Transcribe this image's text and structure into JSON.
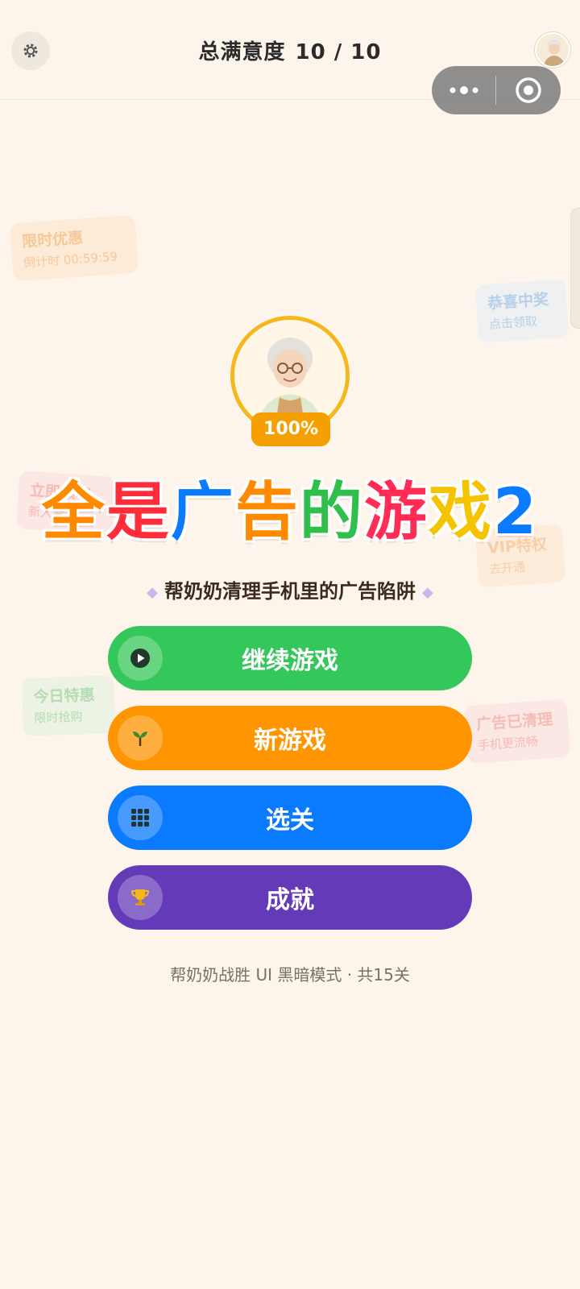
{
  "header": {
    "title": "总满意度",
    "score": "10 / 10"
  },
  "ad_tags": [
    {
      "line1": "限时优惠",
      "line2": "倒计时 00:59:59"
    },
    {
      "line1": "恭喜中奖",
      "line2": "点击领取"
    },
    {
      "line1": "立即领取",
      "line2": "新人专享"
    },
    {
      "line1": "VIP特权",
      "line2": "去开通"
    },
    {
      "line1": "今日特惠",
      "line2": "限时抢购"
    },
    {
      "line1": "广告已清理",
      "line2": "手机更流畅"
    }
  ],
  "hero": {
    "satisfaction_badge": "100%"
  },
  "title": {
    "chars": [
      "全",
      "是",
      "广",
      "告",
      "的",
      "游",
      "戏",
      "2"
    ],
    "colors": [
      "#ff8a00",
      "#ff2d3a",
      "#0a7afe",
      "#ff8a00",
      "#2fbf4a",
      "#ff2d55",
      "#f5c400",
      "#0a7afe"
    ]
  },
  "subtitle": "帮奶奶清理手机里的广告陷阱",
  "menu": {
    "continue_label": "继续游戏",
    "new_label": "新游戏",
    "levels_label": "选关",
    "achievements_label": "成就"
  },
  "footer": "帮奶奶战胜 UI 黑暗模式 · 共15关",
  "colors": {
    "background": "#fdf5ec",
    "continue": "#34c759",
    "new": "#ff9500",
    "levels": "#0a7afe",
    "achievements": "#653ab8",
    "badge": "#f5a000"
  },
  "icons": {
    "settings": "gear-icon",
    "more": "more-dots-icon",
    "close_target": "target-icon",
    "continue": "play-icon",
    "new": "sprout-icon",
    "levels": "grid-icon",
    "achievements": "trophy-icon"
  }
}
